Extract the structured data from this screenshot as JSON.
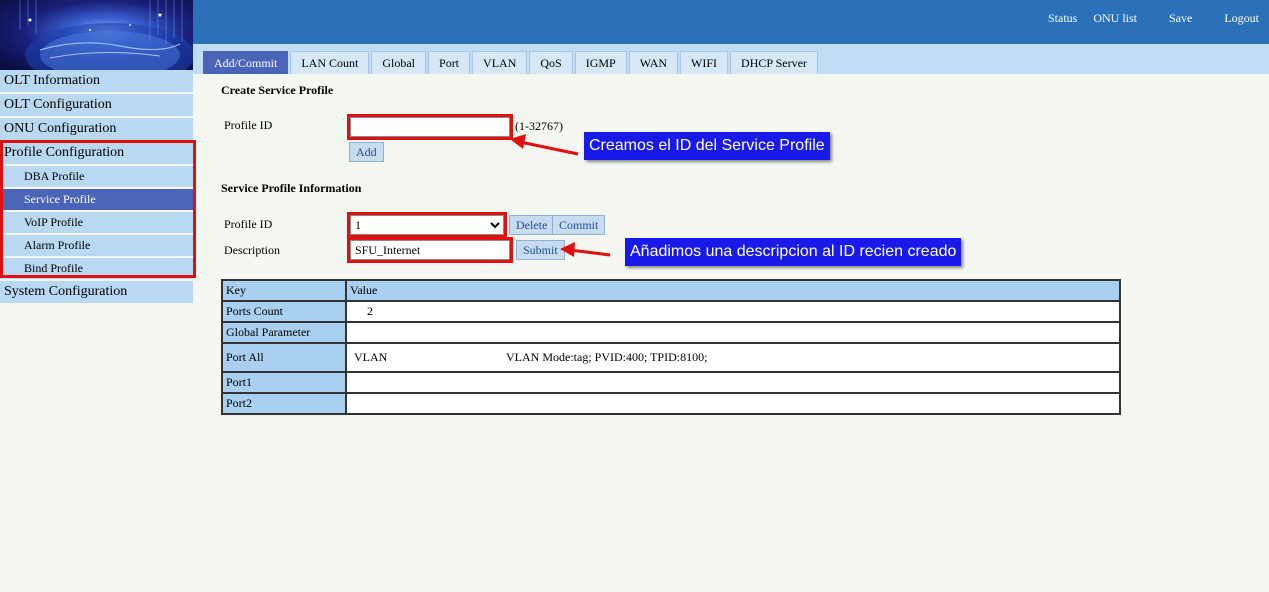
{
  "header": {
    "links": {
      "status": "Status",
      "onu_list": "ONU list",
      "save": "Save",
      "logout": "Logout"
    }
  },
  "sidebar": {
    "olt_information": "OLT Information",
    "olt_configuration": "OLT Configuration",
    "onu_configuration": "ONU Configuration",
    "profile_configuration": "Profile Configuration",
    "profile_items": [
      "DBA Profile",
      "Service Profile",
      "VoIP Profile",
      "Alarm Profile",
      "Bind Profile"
    ],
    "active_item": "Service Profile",
    "system_configuration": "System Configuration"
  },
  "tabs": [
    "Add/Commit",
    "LAN Count",
    "Global",
    "Port",
    "VLAN",
    "QoS",
    "IGMP",
    "WAN",
    "WIFI",
    "DHCP Server"
  ],
  "create": {
    "title": "Create Service Profile",
    "profile_id_label": "Profile ID",
    "profile_id_value": "",
    "range_hint": "(1-32767)",
    "add_label": "Add"
  },
  "info": {
    "title": "Service Profile Information",
    "profile_id_label": "Profile ID",
    "profile_id_selected": "1",
    "delete_label": "Delete",
    "commit_label": "Commit",
    "description_label": "Description",
    "description_value": "SFU_Internet",
    "submit_label": "Submit"
  },
  "table": {
    "key_header": "Key",
    "value_header": "Value",
    "ports_count_key": "Ports Count",
    "ports_count_value": "2",
    "global_parameter_key": "Global Parameter",
    "port_all_key": "Port All",
    "port_all_vlan": "VLAN",
    "port_all_detail": "VLAN Mode:tag; PVID:400; TPID:8100;",
    "port1_key": "Port1",
    "port2_key": "Port2"
  },
  "annotations": {
    "callout_1": "Creamos el ID del Service Profile",
    "callout_2": "Añadimos una descripcion al ID recien creado",
    "annotation_color": "#e01010",
    "callout_color": "#1a1ae8"
  },
  "colors": {
    "header_blue": "#2a71b9",
    "nav_bg": "#b9d8f2",
    "active_bg": "#4a64b8",
    "page_bg": "#f3f7f0"
  }
}
